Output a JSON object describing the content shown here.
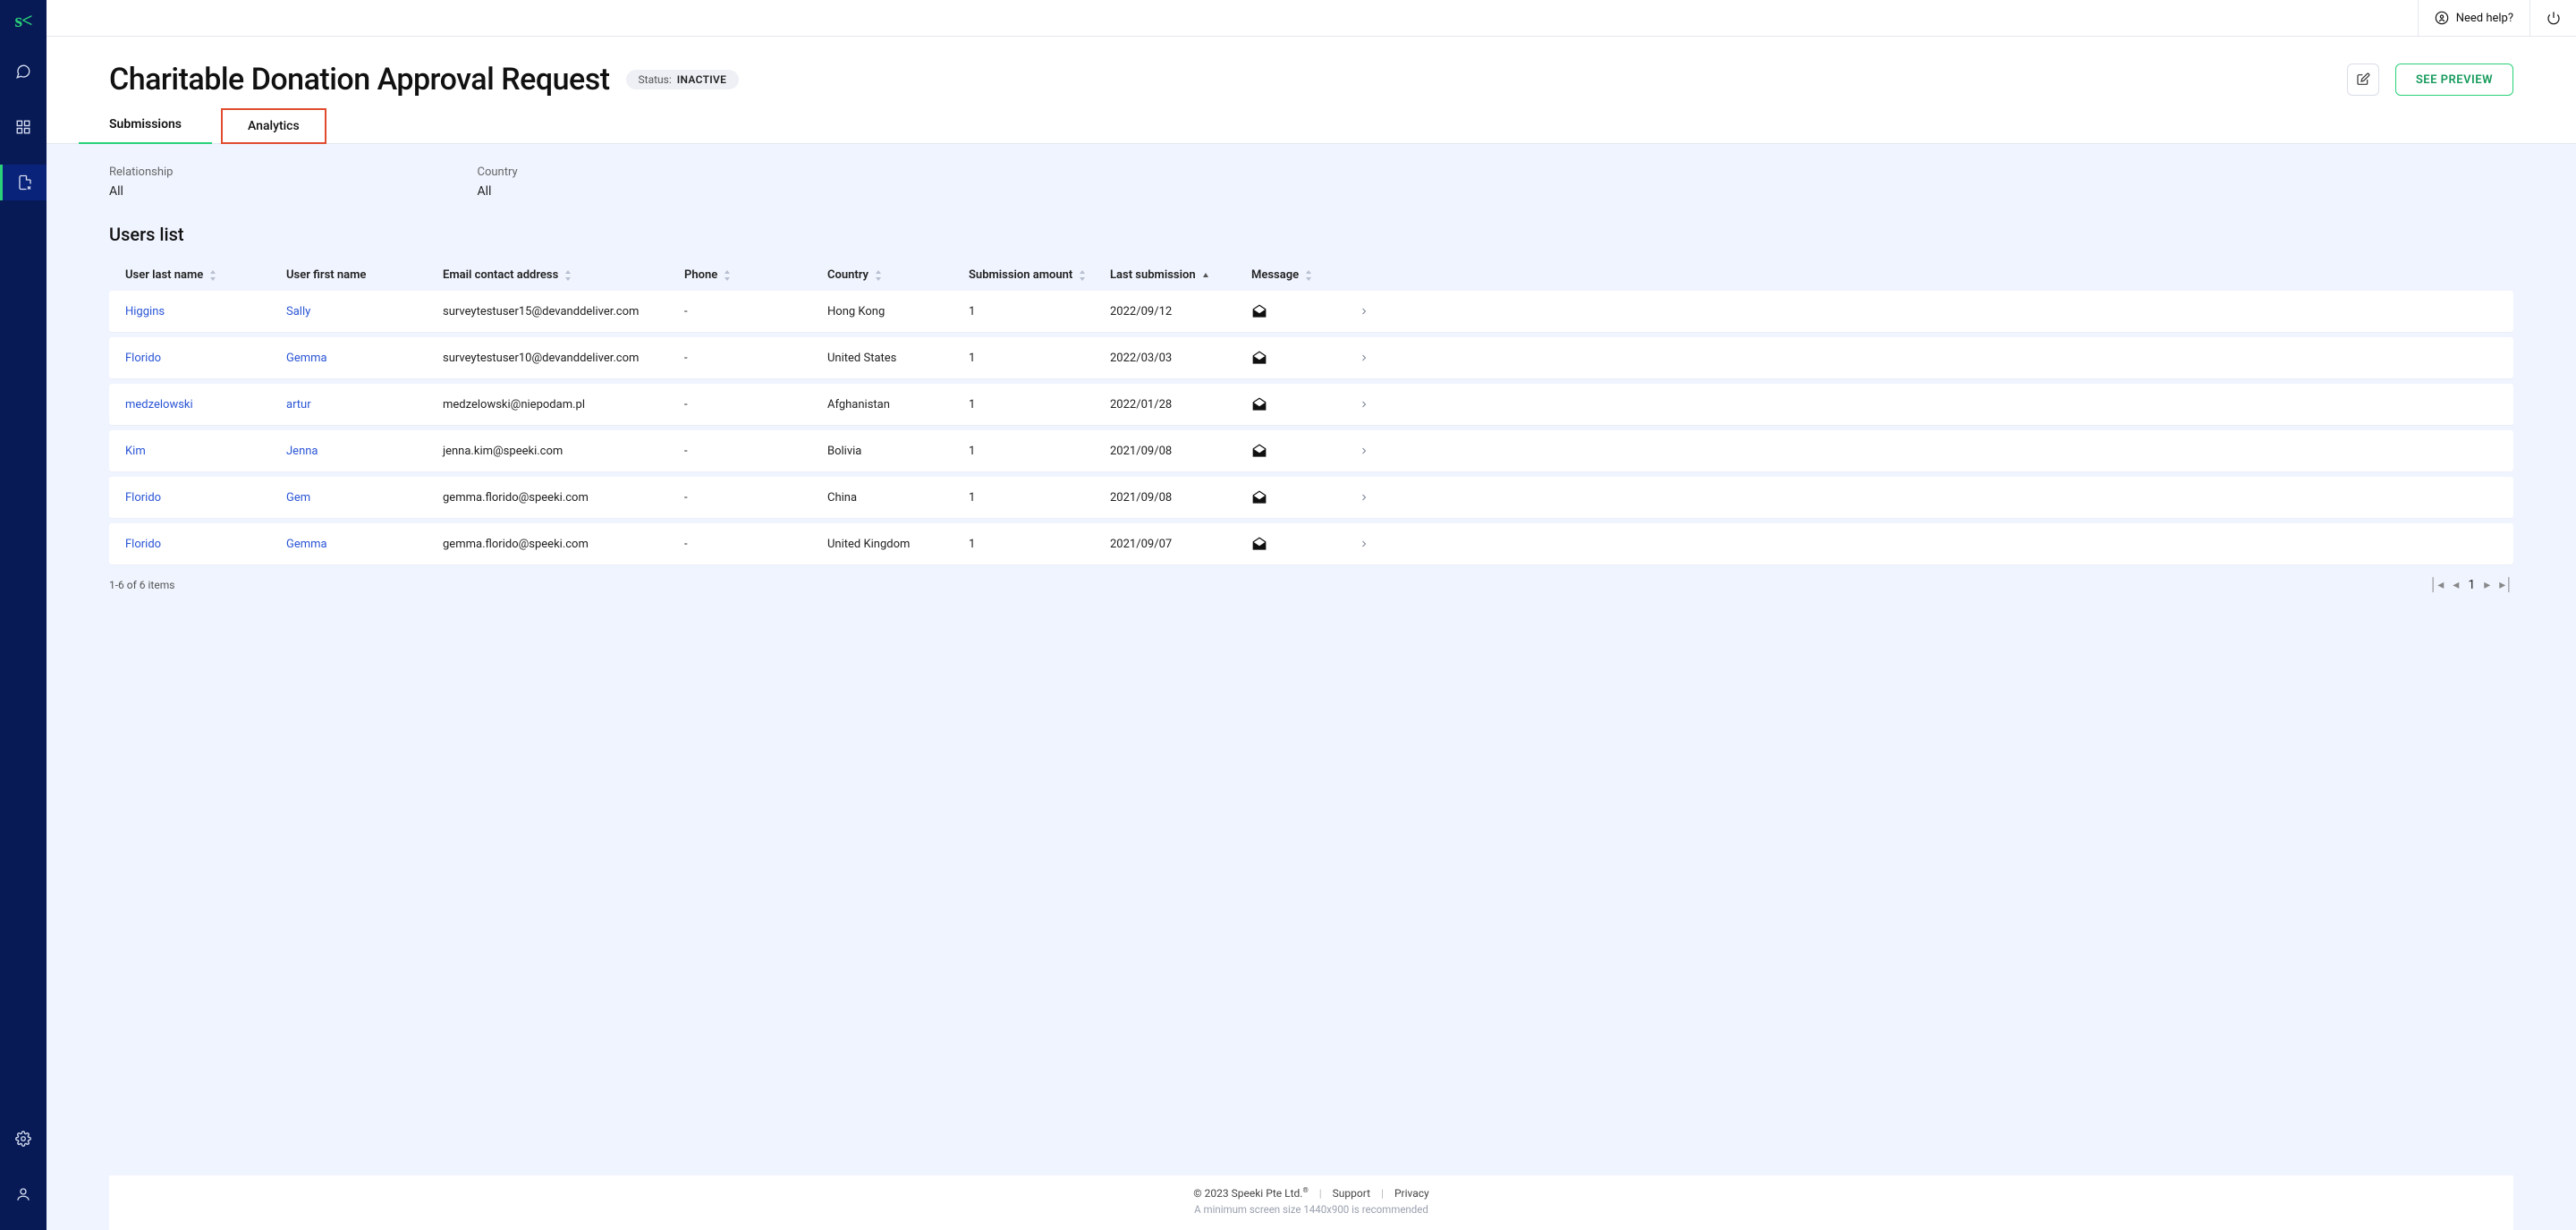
{
  "header": {
    "title": "Charitable Donation Approval Request",
    "status_label": "Status:",
    "status_value": "INACTIVE",
    "help_label": "Need help?",
    "preview_label": "SEE PREVIEW"
  },
  "tabs": {
    "submissions": "Submissions",
    "analytics": "Analytics"
  },
  "filters": {
    "relationship_label": "Relationship",
    "relationship_value": "All",
    "country_label": "Country",
    "country_value": "All"
  },
  "section": {
    "users_list_title": "Users list"
  },
  "columns": {
    "last_name": "User last name",
    "first_name": "User first name",
    "email": "Email contact address",
    "phone": "Phone",
    "country": "Country",
    "amount": "Submission amount",
    "last_submission": "Last submission",
    "message": "Message"
  },
  "rows": [
    {
      "last_name": "Higgins",
      "first_name": "Sally",
      "email": "surveytestuser15@devanddeliver.com",
      "phone": "-",
      "country": "Hong Kong",
      "amount": "1",
      "last_submission": "2022/09/12"
    },
    {
      "last_name": "Florido",
      "first_name": "Gemma",
      "email": "surveytestuser10@devanddeliver.com",
      "phone": "-",
      "country": "United States",
      "amount": "1",
      "last_submission": "2022/03/03"
    },
    {
      "last_name": "medzelowski",
      "first_name": "artur",
      "email": "medzelowski@niepodam.pl",
      "phone": "-",
      "country": "Afghanistan",
      "amount": "1",
      "last_submission": "2022/01/28"
    },
    {
      "last_name": "Kim",
      "first_name": "Jenna",
      "email": "jenna.kim@speeki.com",
      "phone": "-",
      "country": "Bolivia",
      "amount": "1",
      "last_submission": "2021/09/08"
    },
    {
      "last_name": "Florido",
      "first_name": "Gem",
      "email": "gemma.florido@speeki.com",
      "phone": "-",
      "country": "China",
      "amount": "1",
      "last_submission": "2021/09/08"
    },
    {
      "last_name": "Florido",
      "first_name": "Gemma",
      "email": "gemma.florido@speeki.com",
      "phone": "-",
      "country": "United Kingdom",
      "amount": "1",
      "last_submission": "2021/09/07"
    }
  ],
  "pagination": {
    "summary": "1-6 of 6 items",
    "current_page": "1"
  },
  "footer": {
    "copyright": "© 2023 Speeki Pte Ltd.",
    "support": "Support",
    "privacy": "Privacy",
    "min_screen": "A minimum screen size 1440x900 is recommended"
  },
  "logo_text": "s<"
}
